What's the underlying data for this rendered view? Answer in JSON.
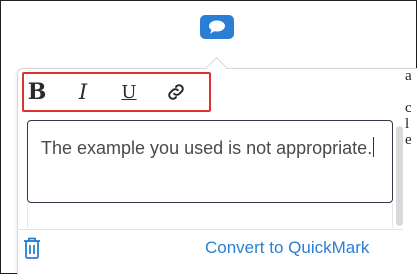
{
  "colors": {
    "accent": "#2a7fd4",
    "highlight": "#e03131",
    "text": "#4a4a4a"
  },
  "header": {
    "icon": "speech-bubble-icon"
  },
  "toolbar": {
    "bold_label": "B",
    "italic_label": "I",
    "underline_label": "U",
    "link_icon": "link-icon"
  },
  "editor": {
    "text": "The example you used is not appropriate."
  },
  "right_sliver": {
    "text": "a\n\nc\nl\ne"
  },
  "footer": {
    "delete_icon": "trash-icon",
    "convert_label": "Convert to QuickMark"
  }
}
